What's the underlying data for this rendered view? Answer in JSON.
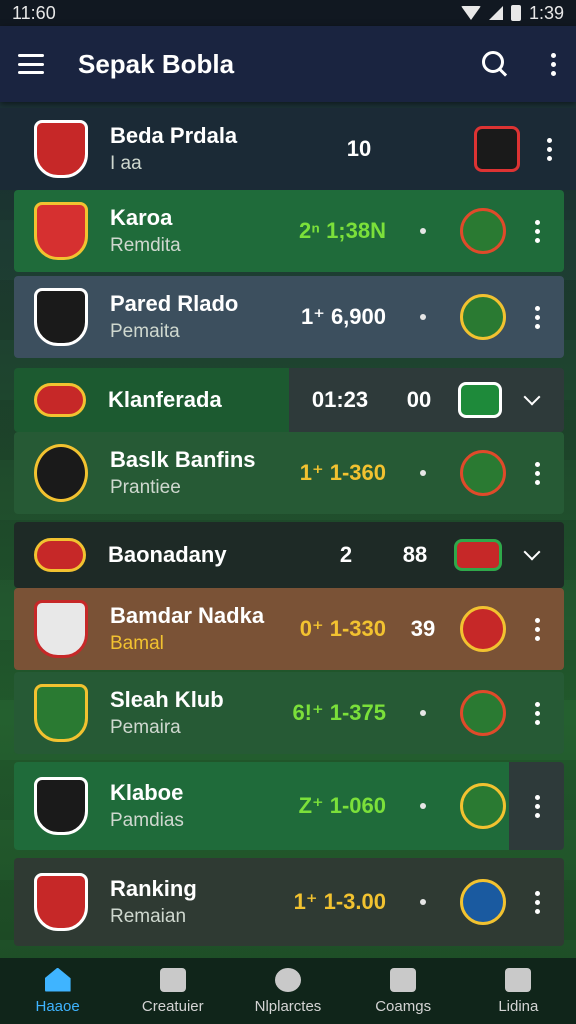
{
  "status_bar": {
    "time": "11:60",
    "clock": "1:39"
  },
  "app_bar": {
    "title": "Sepak Bobla"
  },
  "rows": [
    {
      "name": "Beda Prdala",
      "sub": "I aa",
      "score": "10",
      "value": "",
      "score_color": "#ffffff"
    },
    {
      "name": "Karoa",
      "sub": "Remdita",
      "score": "2ⁿ 1;38N",
      "value": "",
      "score_color": "#7be03a"
    },
    {
      "name": "Pared Rlado",
      "sub": "Pemaita",
      "score": "1⁺ 6,900",
      "value": "",
      "score_color": "#ffffff"
    },
    {
      "name": "Klanferada",
      "sub": "",
      "score": "01:23",
      "value": "00",
      "score_color": "#ffffff"
    },
    {
      "name": "Baslk Banfins",
      "sub": "Prantiee",
      "score": "1⁺ 1-360",
      "value": "",
      "score_color": "#f2c230"
    },
    {
      "name": "Baonadany",
      "sub": "",
      "score": "2",
      "value": "88",
      "score_color": "#ffffff"
    },
    {
      "name": "Bamdar Nadka",
      "sub": "Bamal",
      "score": "0⁺ 1-330",
      "value": "39",
      "score_color": "#f2c230"
    },
    {
      "name": "Sleah Klub",
      "sub": "Pemaira",
      "score": "6!⁺ 1-375",
      "value": "",
      "score_color": "#7be03a"
    },
    {
      "name": "Klaboe",
      "sub": "Pamdias",
      "score": "Z⁺ 1-060",
      "value": "",
      "score_color": "#7be03a"
    },
    {
      "name": "Ranking",
      "sub": "Remaian",
      "score": "1⁺ 1-3.00",
      "value": "",
      "score_color": "#f2c230"
    }
  ],
  "nav": [
    {
      "label": "Haaoe",
      "icon": "home-icon",
      "active": true
    },
    {
      "label": "Creatuier",
      "icon": "document-icon",
      "active": false
    },
    {
      "label": "Nlplarctes",
      "icon": "ball-icon",
      "active": false
    },
    {
      "label": "Coamgs",
      "icon": "calendar-icon",
      "active": false
    },
    {
      "label": "Lidina",
      "icon": "profile-icon",
      "active": false
    }
  ],
  "colors": {
    "app_bar": "#1a2440",
    "row_green": "#1f6b3a",
    "row_slate": "#3c4f5e",
    "row_brown": "#7a5236",
    "row_dark": "#1e2a26",
    "accent_blue": "#3fb4ff",
    "accent_yellow": "#f2c230",
    "accent_green": "#7be03a"
  }
}
